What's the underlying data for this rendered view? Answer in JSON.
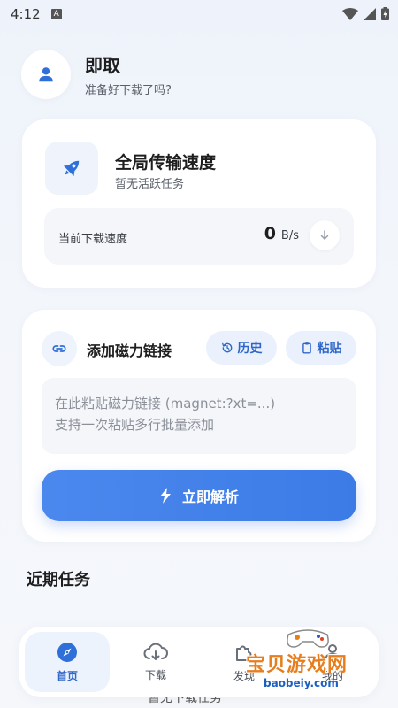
{
  "status_bar": {
    "time": "4:12",
    "notification": "A"
  },
  "header": {
    "title": "即取",
    "subtitle": "准备好下载了吗?"
  },
  "speed_card": {
    "title": "全局传输速度",
    "subtitle": "暂无活跃任务",
    "label": "当前下载速度",
    "value": "0",
    "unit": "B/s"
  },
  "magnet_card": {
    "title": "添加磁力链接",
    "history_label": "历史",
    "paste_label": "粘贴",
    "placeholder_line1": "在此粘贴磁力链接 (magnet:?xt=...)",
    "placeholder_line2": "支持一次粘贴多行批量添加",
    "parse_label": "立即解析"
  },
  "recent": {
    "title": "近期任务",
    "empty_text": "暂无下载任务"
  },
  "nav": {
    "items": [
      {
        "label": "首页",
        "icon": "compass-icon",
        "active": true
      },
      {
        "label": "下载",
        "icon": "cloud-download-icon",
        "active": false
      },
      {
        "label": "发现",
        "icon": "puzzle-icon",
        "active": false
      },
      {
        "label": "我的",
        "icon": "user-icon",
        "active": false
      }
    ]
  },
  "watermark": {
    "text": "宝贝游戏网",
    "url": "baobeiy.com"
  },
  "colors": {
    "accent": "#3c7be6",
    "accent_light": "#eaf1fd",
    "background": "#f3f6fb"
  }
}
